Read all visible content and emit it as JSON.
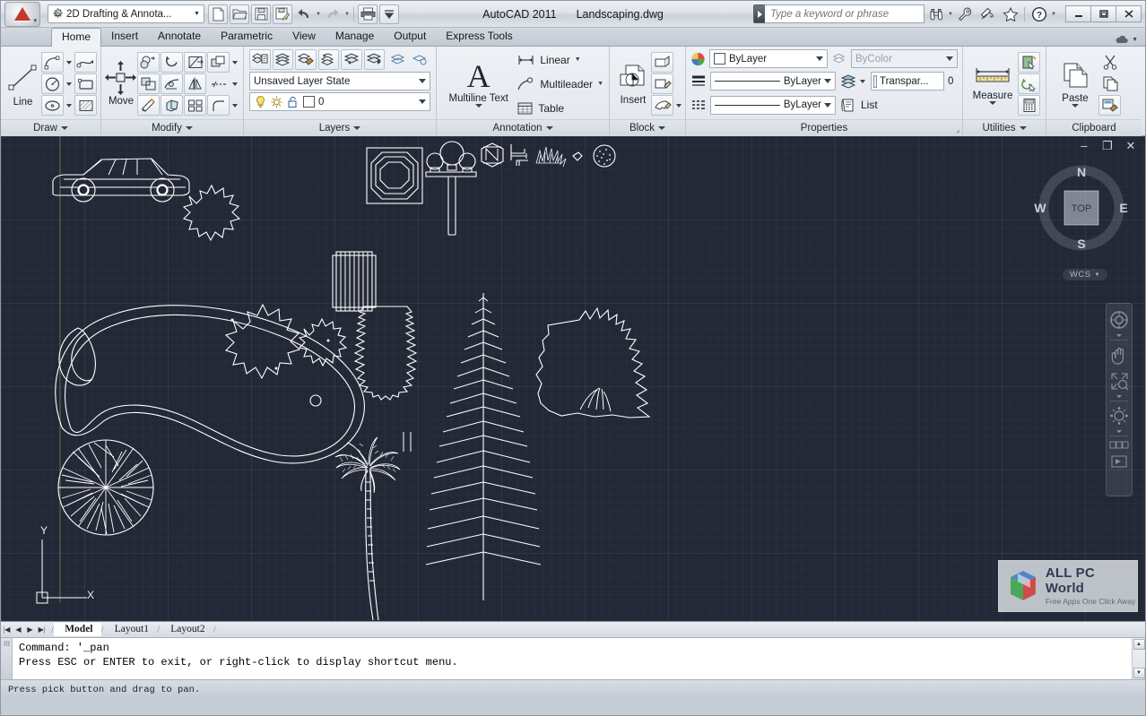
{
  "titlebar": {
    "app_button": "autocad-a-logo",
    "workspace": {
      "label": "2D Drafting & Annota...",
      "icon": "gear-icon"
    },
    "quick_access": [
      {
        "name": "new-file",
        "icon": "page-icon"
      },
      {
        "name": "open-file",
        "icon": "folder-icon"
      },
      {
        "name": "save-file",
        "icon": "floppy-icon"
      },
      {
        "name": "save-as",
        "icon": "floppy-pencil-icon"
      },
      {
        "name": "undo",
        "icon": "undo-arrow-icon"
      },
      {
        "name": "redo",
        "icon": "redo-arrow-icon"
      },
      {
        "name": "plot",
        "icon": "printer-icon"
      },
      {
        "name": "qat-customize",
        "icon": "chevron-down-icon"
      }
    ],
    "product": "AutoCAD 2011",
    "document": "Landscaping.dwg",
    "search": {
      "placeholder": "Type a keyword or phrase"
    },
    "right_icons": [
      {
        "name": "infocenter-search-icon",
        "glyph": "binoculars-icon"
      },
      {
        "name": "sign-in-icon",
        "glyph": "wrench-icon"
      },
      {
        "name": "exchange-apps-icon",
        "glyph": "satellite-icon"
      },
      {
        "name": "favorites-icon",
        "glyph": "star-icon"
      },
      {
        "name": "help-icon",
        "glyph": "question-mark-icon"
      }
    ],
    "window_controls": [
      {
        "name": "minimize-button",
        "glyph": "minimize-icon"
      },
      {
        "name": "restore-button",
        "glyph": "restore-icon"
      },
      {
        "name": "close-button",
        "glyph": "close-icon"
      }
    ]
  },
  "ribbon_tabs": {
    "items": [
      "Home",
      "Insert",
      "Annotate",
      "Parametric",
      "View",
      "Manage",
      "Output",
      "Express Tools"
    ],
    "active": "Home"
  },
  "ribbon": {
    "panels": [
      {
        "title": "Draw",
        "big_button": {
          "label": "Line",
          "icon": "line-icon"
        },
        "tools": [
          [
            "arc-icon",
            "polyline-icon"
          ],
          [
            "circle-icon",
            "rectangle-icon"
          ],
          [
            "ellipse-icon",
            "hatch-icon"
          ]
        ]
      },
      {
        "title": "Modify",
        "big_button": {
          "label": "Move",
          "icon": "move-arrows-icon"
        },
        "tools": [
          [
            "copy-icon",
            "rotate-icon",
            "trim-icon",
            "array-icon"
          ],
          [
            "scale-icon",
            "extend-icon",
            "mirror-icon",
            "stretch-icon"
          ],
          [
            "erase-icon",
            "explode-icon",
            "offset-icon",
            "fillet-icon"
          ]
        ]
      },
      {
        "title": "Layers",
        "layer_state": "Unsaved Layer State",
        "layer_name": "0",
        "tools": [
          "layer-properties-icon",
          "layer-match-icon",
          "layer-paint-icon",
          "layer-previous-icon",
          "layer-make-current-icon",
          "layer-walk-icon",
          "layer-isolate-icon",
          "layer-off-icon"
        ],
        "props": [
          "lightbulb-icon",
          "sun-icon",
          "unlock-icon",
          "color-swatch"
        ]
      },
      {
        "title": "Annotation",
        "big_button": {
          "label": "Multiline Text",
          "icon": "text-a-icon"
        },
        "items": [
          {
            "label": "Linear",
            "icon": "linear-dimension-icon",
            "dropdown": true
          },
          {
            "label": "Multileader",
            "icon": "multileader-icon",
            "dropdown": true
          },
          {
            "label": "Table",
            "icon": "table-icon",
            "dropdown": false
          }
        ]
      },
      {
        "title": "Block",
        "big_button": {
          "label": "Insert",
          "icon": "insert-block-icon"
        },
        "tools": [
          "create-block-icon",
          "edit-block-icon",
          "edit-attribute-icon"
        ]
      },
      {
        "title": "Properties",
        "rows": [
          {
            "icon": "color-wheel-icon",
            "value": "ByLayer",
            "swatch": "#ffffff",
            "second": {
              "icon": "plot-style-icon",
              "value": "ByColor",
              "disabled": true
            }
          },
          {
            "icon": "lineweight-icon",
            "value": "ByLayer",
            "second": {
              "icon": "layer-transparency-icon",
              "value": "Transpar...",
              "extra": "0"
            }
          },
          {
            "icon": "linetype-icon",
            "value": "ByLayer",
            "second": {
              "icon": "list-icon",
              "value": "List"
            }
          }
        ]
      },
      {
        "title": "Utilities",
        "big_button": {
          "label": "Measure",
          "icon": "ruler-icon"
        },
        "tools": [
          "quick-select-icon",
          "quick-calc-measure-icon",
          "calculator-icon"
        ]
      },
      {
        "title": "Clipboard",
        "big_button": {
          "label": "Paste",
          "icon": "paste-icon"
        },
        "tools": [
          "cut-icon",
          "copy-clip-icon",
          "paste-special-icon"
        ]
      }
    ]
  },
  "drawing": {
    "window_controls": [
      {
        "name": "drawing-minimize-button",
        "glyph": "–"
      },
      {
        "name": "drawing-restore-button",
        "glyph": "❐"
      },
      {
        "name": "drawing-close-button",
        "glyph": "✕"
      }
    ],
    "viewcube": {
      "top": "TOP",
      "north": "N",
      "south": "S",
      "east": "E",
      "west": "W"
    },
    "ucs_label": "WCS",
    "ucs_axes": {
      "x": "X",
      "y": "Y"
    },
    "navbar": [
      {
        "name": "steering-wheel-icon"
      },
      {
        "name": "pan-hand-icon"
      },
      {
        "name": "zoom-extents-icon"
      },
      {
        "name": "orbit-icon"
      },
      {
        "name": "showmotion-icon"
      }
    ],
    "watermark": {
      "title": "ALL PC World",
      "tagline": "Free Apps One Click Away"
    },
    "objects": [
      "car-side-elevation",
      "shrub-plan-cluster",
      "octagon-block",
      "striped-rectangle",
      "lollipop-trees-on-pole",
      "hexagon-north-symbol",
      "bench-symbol",
      "bush-sketch",
      "small-leaf",
      "stippled-circle",
      "pond-outline",
      "radial-tree-plan",
      "conifer-elevation-1",
      "conifer-elevation-2",
      "deciduous-tree-elevation",
      "shrub-elevation",
      "palm-tree-elevation"
    ]
  },
  "layout_tabs": {
    "nav": [
      "first-layout-button",
      "previous-layout-button",
      "next-layout-button",
      "last-layout-button"
    ],
    "items": [
      "Model",
      "Layout1",
      "Layout2"
    ],
    "active": "Model"
  },
  "command_line": {
    "lines": [
      "Command: '_pan",
      "Press ESC or ENTER to exit, or right-click to display shortcut menu."
    ]
  },
  "status_bar": {
    "text": "Press pick button and drag to pan."
  },
  "colors": {
    "canvas": "#232836",
    "ribbon": "#eef1f5",
    "accent": "#c0392b",
    "draw_stroke": "#ffffff"
  }
}
